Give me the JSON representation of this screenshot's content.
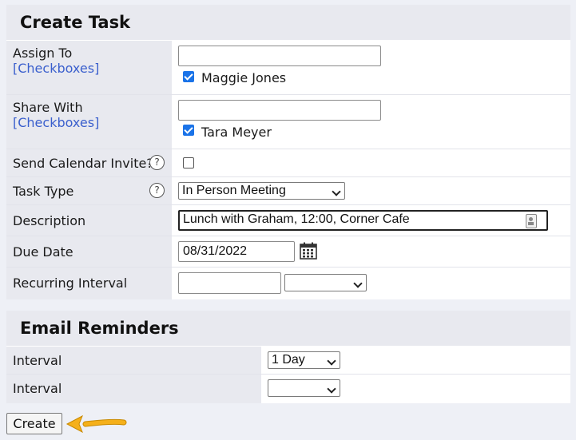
{
  "create_task": {
    "title": "Create Task",
    "assign_to": {
      "label": "Assign To",
      "link": "[Checkboxes]",
      "input_value": "",
      "checked_name": "Maggie Jones"
    },
    "share_with": {
      "label": "Share With",
      "link": "[Checkboxes]",
      "input_value": "",
      "checked_name": "Tara Meyer"
    },
    "send_invite": {
      "label": "Send Calendar Invite?",
      "help": "?",
      "checked": false
    },
    "task_type": {
      "label": "Task Type",
      "help": "?",
      "selected": "In Person Meeting"
    },
    "description": {
      "label": "Description",
      "value": "Lunch with Graham, 12:00, Corner Cafe"
    },
    "due_date": {
      "label": "Due Date",
      "value": "08/31/2022"
    },
    "recurring": {
      "label": "Recurring Interval",
      "value": "",
      "selected": ""
    }
  },
  "email_reminders": {
    "title": "Email Reminders",
    "rows": [
      {
        "label": "Interval",
        "selected": "1 Day"
      },
      {
        "label": "Interval",
        "selected": ""
      }
    ]
  },
  "create_button": "Create",
  "colors": {
    "link": "#3a5fcd",
    "checkbox": "#1a73e8",
    "arrow": "#f5b01a"
  }
}
